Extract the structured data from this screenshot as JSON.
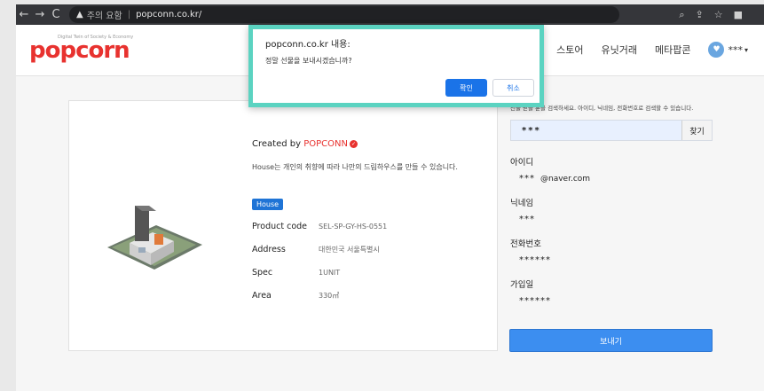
{
  "browser": {
    "back_icon": "back-arrow-icon",
    "forward_icon": "forward-arrow-icon",
    "reload_icon": "reload-icon",
    "security_warning": "주의 요함",
    "url": "popconn.co.kr/",
    "right_icons": [
      "search-icon",
      "share-icon",
      "star-icon",
      "sidebar-icon"
    ]
  },
  "header": {
    "logo": "popcorn",
    "logo_tag": "Digital Twin of Society & Economy",
    "nav": [
      "스토어",
      "유닛거래",
      "메타팝콘"
    ],
    "user_name": "***"
  },
  "dialog": {
    "title": "popconn.co.kr 내용:",
    "message": "정말 선물을 보내시겠습니까?",
    "ok_label": "확인",
    "cancel_label": "취소",
    "border_color": "#5bd3c1"
  },
  "product": {
    "created_by_prefix": "Created by ",
    "creator": "POPCONN",
    "description": "House는 개인의 취향에 따라 나만의 드림하우스를 만들 수 있습니다.",
    "category": "House",
    "specs": [
      {
        "label": "Product code",
        "value": "SEL-SP-GY-HS-0551"
      },
      {
        "label": "Address",
        "value": "대한민국 서울특별시"
      },
      {
        "label": "Spec",
        "value": "1UNIT"
      },
      {
        "label": "Area",
        "value": "330㎡"
      }
    ]
  },
  "gift_panel": {
    "hint": "선물 받을 분을 검색하세요. 아이디, 닉네임, 전화번호로 검색할 수 있습니다.",
    "search_value": "***",
    "search_button": "찾기",
    "id_label": "아이디",
    "id_value": "***",
    "id_domain": "@naver.com",
    "nickname_label": "닉네임",
    "nickname_value": "***",
    "phone_label": "전화번호",
    "phone_value": "******",
    "joined_label": "가입일",
    "joined_value": "******",
    "send_button": "보내기"
  },
  "colors": {
    "brand": "#e8322f",
    "primary": "#3c8ef0"
  }
}
